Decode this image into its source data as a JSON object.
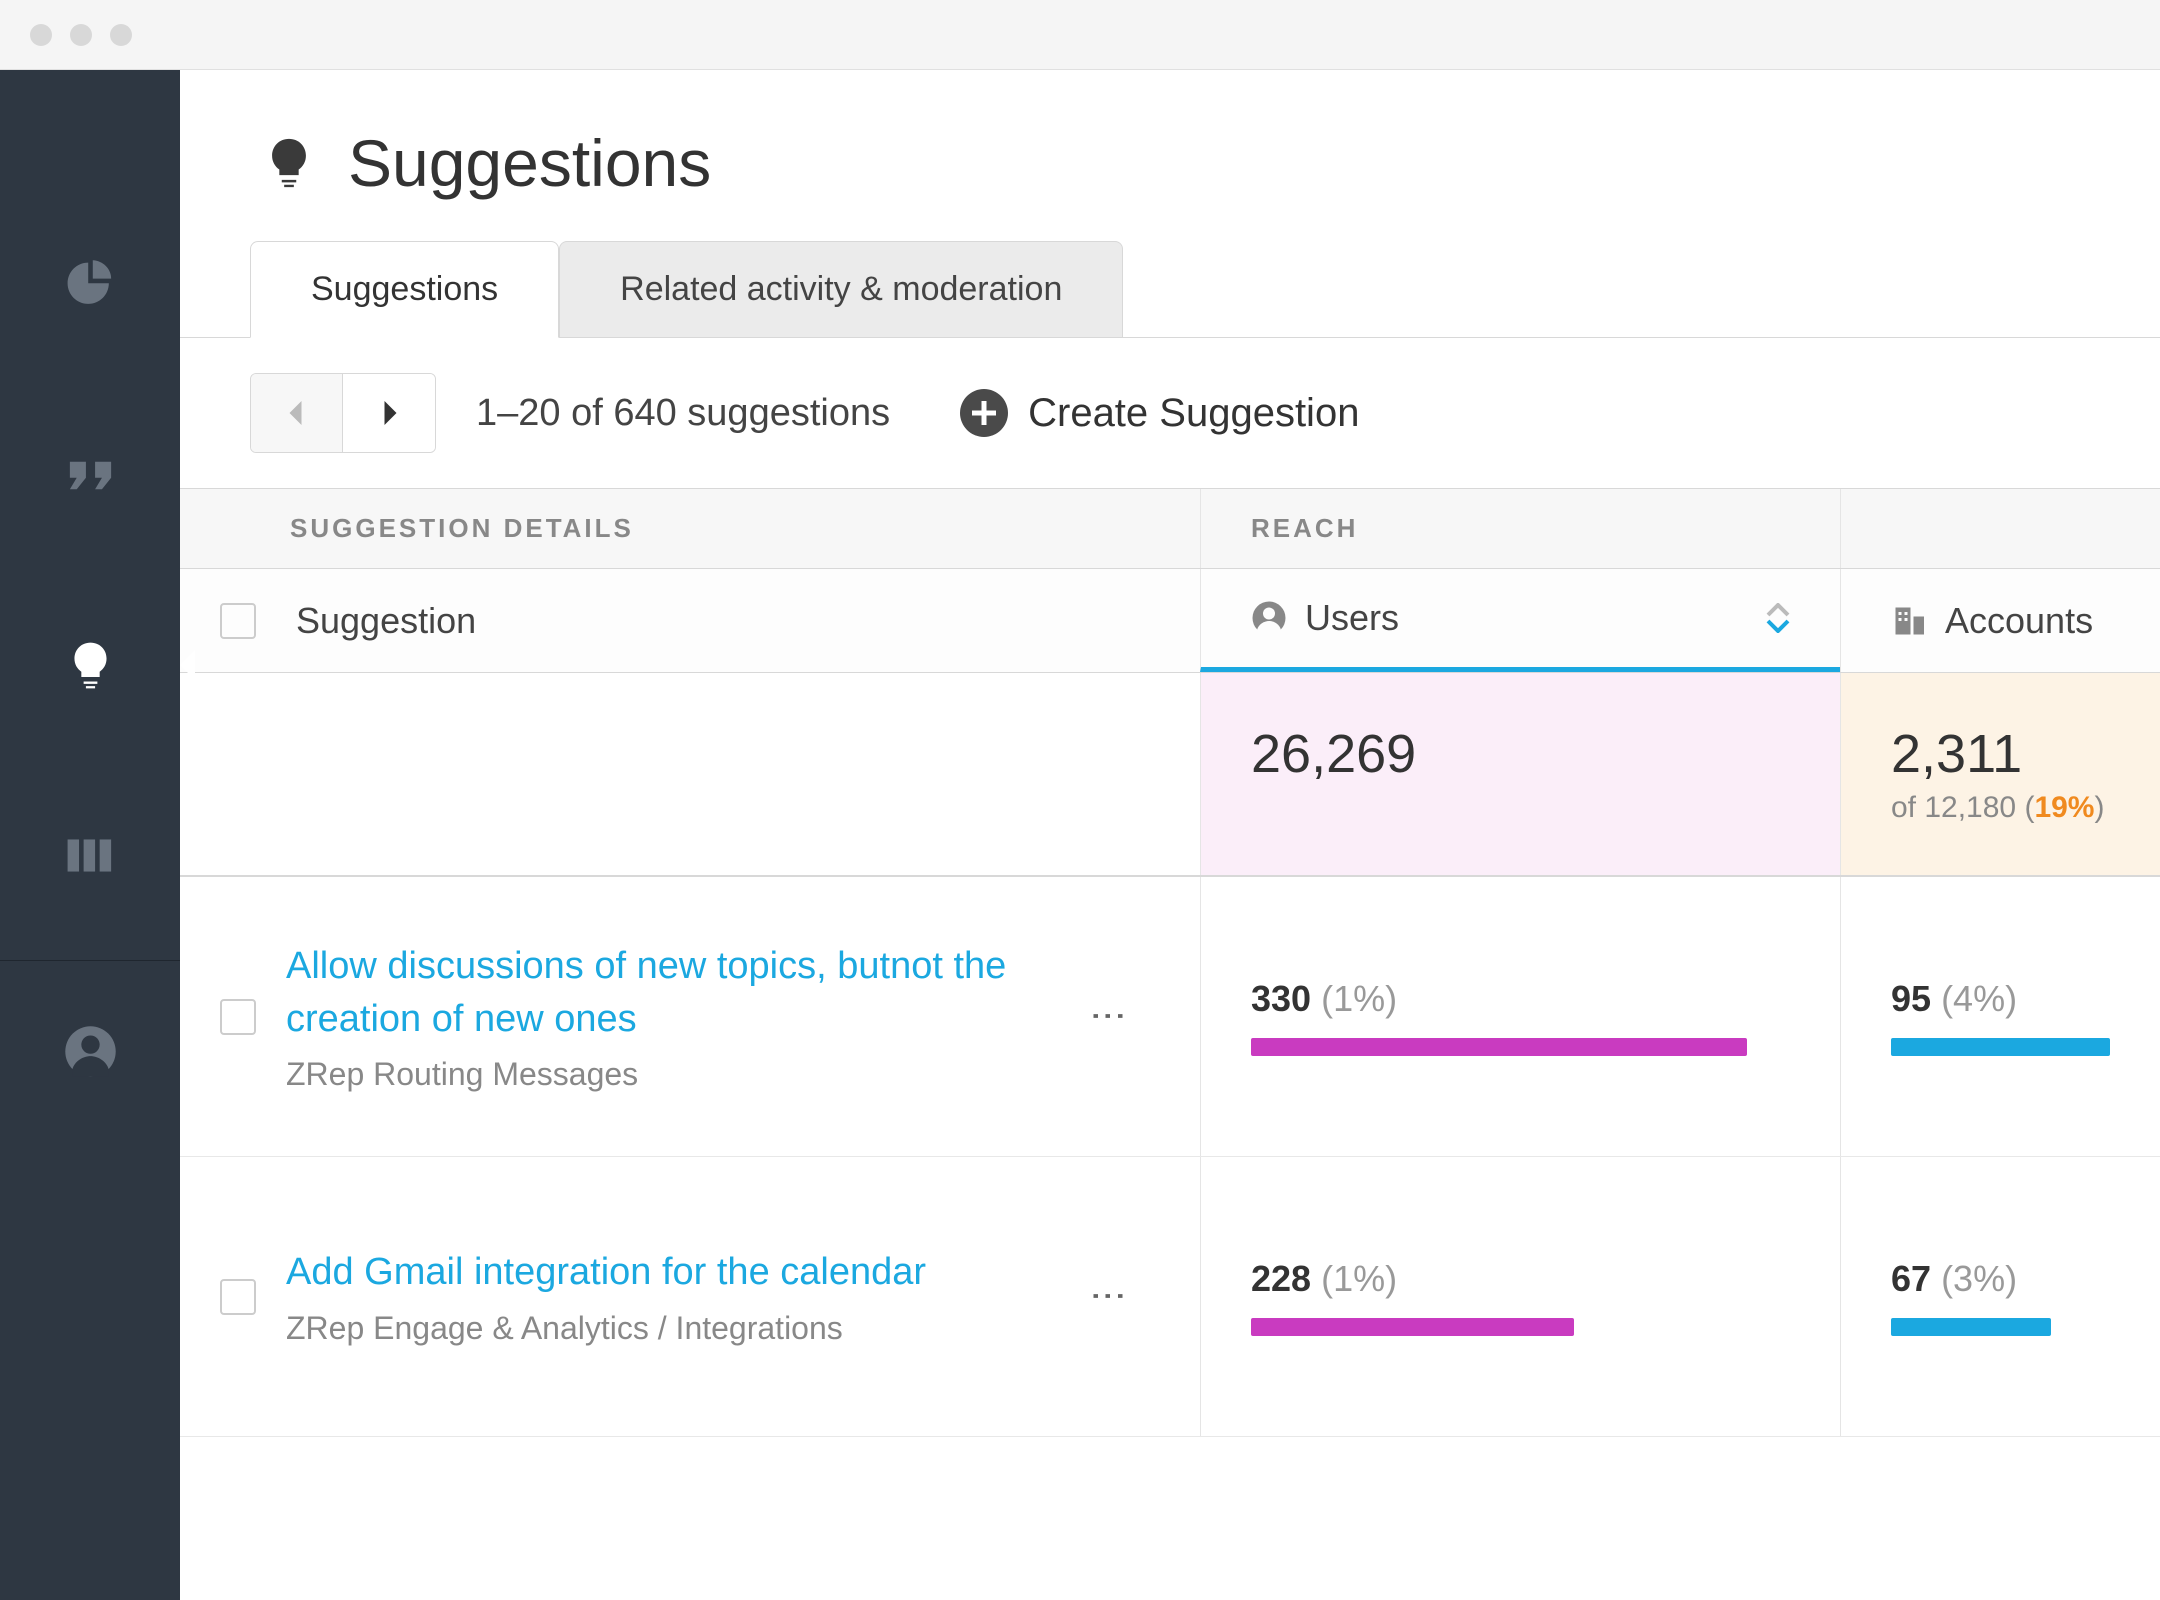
{
  "page": {
    "title": "Suggestions"
  },
  "tabs": [
    {
      "label": "Suggestions",
      "active": true
    },
    {
      "label": "Related activity & moderation",
      "active": false
    }
  ],
  "toolbar": {
    "range_label": "1–20 of 640 suggestions",
    "create_label": "Create Suggestion"
  },
  "table": {
    "group_headers": {
      "details": "SUGGESTION DETAILS",
      "reach": "REACH"
    },
    "col_headers": {
      "suggestion": "Suggestion",
      "users": "Users",
      "accounts": "Accounts"
    },
    "summary": {
      "users_total": "26,269",
      "accounts_total": "2,311",
      "accounts_of": "of 12,180 (",
      "accounts_pct": "19%",
      "accounts_close": ")"
    },
    "rows": [
      {
        "title": "Allow discussions of new topics, butnot the creation of new ones",
        "category": "ZRep Routing Messages",
        "users_count": "330",
        "users_pct": "(1%)",
        "users_bar_width": "92%",
        "accounts_count": "95",
        "accounts_pct": "(4%)",
        "accounts_bar_width": "100%"
      },
      {
        "title": "Add Gmail integration for the calendar",
        "category": "ZRep Engage & Analytics / Integrations",
        "users_count": "228",
        "users_pct": "(1%)",
        "users_bar_width": "60%",
        "accounts_count": "67",
        "accounts_pct": "(3%)",
        "accounts_bar_width": "73%"
      }
    ]
  }
}
